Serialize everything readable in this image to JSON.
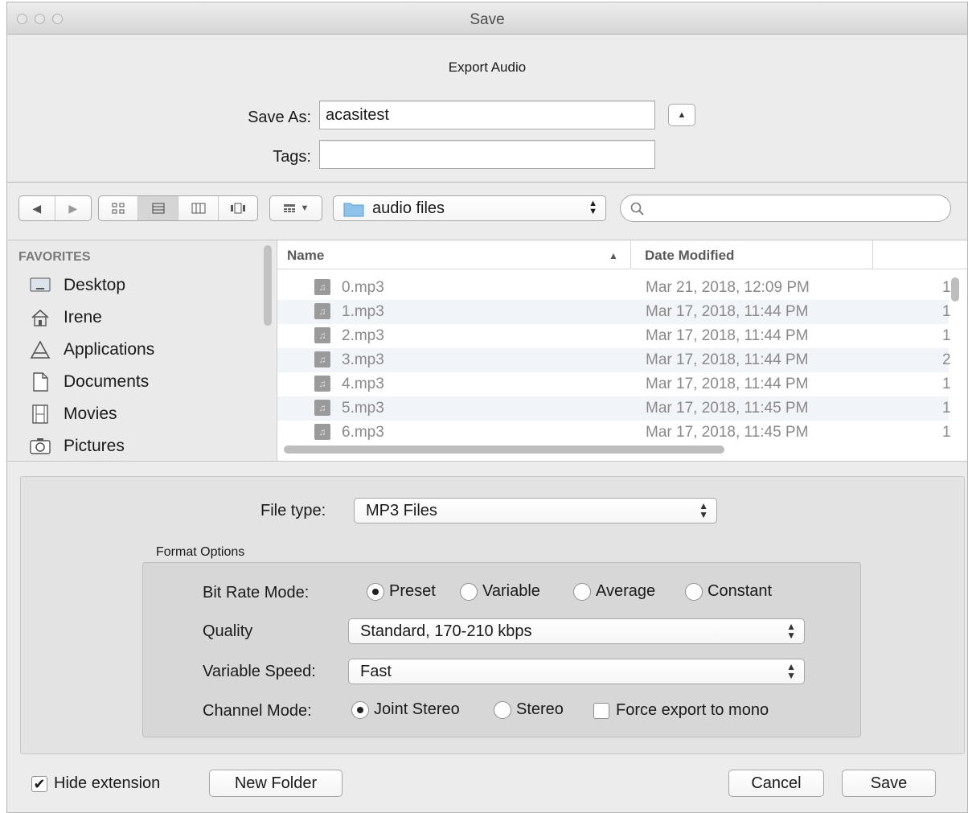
{
  "window": {
    "title": "Save"
  },
  "header": {
    "subtitle": "Export Audio",
    "save_as_label": "Save As:",
    "save_as_value": "acasitest",
    "tags_label": "Tags:",
    "tags_value": ""
  },
  "toolbar": {
    "location": "audio files",
    "search_placeholder": ""
  },
  "sidebar": {
    "section": "FAVORITES",
    "items": [
      {
        "label": "Desktop",
        "icon": "desktop-icon"
      },
      {
        "label": "Irene",
        "icon": "home-icon"
      },
      {
        "label": "Applications",
        "icon": "applications-icon"
      },
      {
        "label": "Documents",
        "icon": "documents-icon"
      },
      {
        "label": "Movies",
        "icon": "movies-icon"
      },
      {
        "label": "Pictures",
        "icon": "pictures-icon"
      }
    ]
  },
  "file_list": {
    "columns": [
      "Name",
      "Date Modified"
    ],
    "rows": [
      {
        "name": "0.mp3",
        "date": "Mar 21, 2018, 12:09 PM",
        "extra": "1"
      },
      {
        "name": "1.mp3",
        "date": "Mar 17, 2018, 11:44 PM",
        "extra": "1"
      },
      {
        "name": "2.mp3",
        "date": "Mar 17, 2018, 11:44 PM",
        "extra": "1"
      },
      {
        "name": "3.mp3",
        "date": "Mar 17, 2018, 11:44 PM",
        "extra": "2"
      },
      {
        "name": "4.mp3",
        "date": "Mar 17, 2018, 11:44 PM",
        "extra": "1"
      },
      {
        "name": "5.mp3",
        "date": "Mar 17, 2018, 11:45 PM",
        "extra": "1"
      },
      {
        "name": "6.mp3",
        "date": "Mar 17, 2018, 11:45 PM",
        "extra": "1"
      }
    ]
  },
  "options": {
    "file_type_label": "File type:",
    "file_type_value": "MP3 Files",
    "format_options_label": "Format Options",
    "bit_rate_mode_label": "Bit Rate Mode:",
    "bit_rate_modes": [
      "Preset",
      "Variable",
      "Average",
      "Constant"
    ],
    "bit_rate_selected": "Preset",
    "quality_label": "Quality",
    "quality_value": "Standard, 170-210 kbps",
    "variable_speed_label": "Variable Speed:",
    "variable_speed_value": "Fast",
    "channel_mode_label": "Channel Mode:",
    "channel_modes": [
      "Joint Stereo",
      "Stereo"
    ],
    "channel_selected": "Joint Stereo",
    "force_mono_label": "Force export to mono",
    "force_mono_checked": false
  },
  "footer": {
    "hide_extension_label": "Hide extension",
    "hide_extension_checked": true,
    "new_folder_label": "New Folder",
    "cancel_label": "Cancel",
    "save_label": "Save"
  }
}
